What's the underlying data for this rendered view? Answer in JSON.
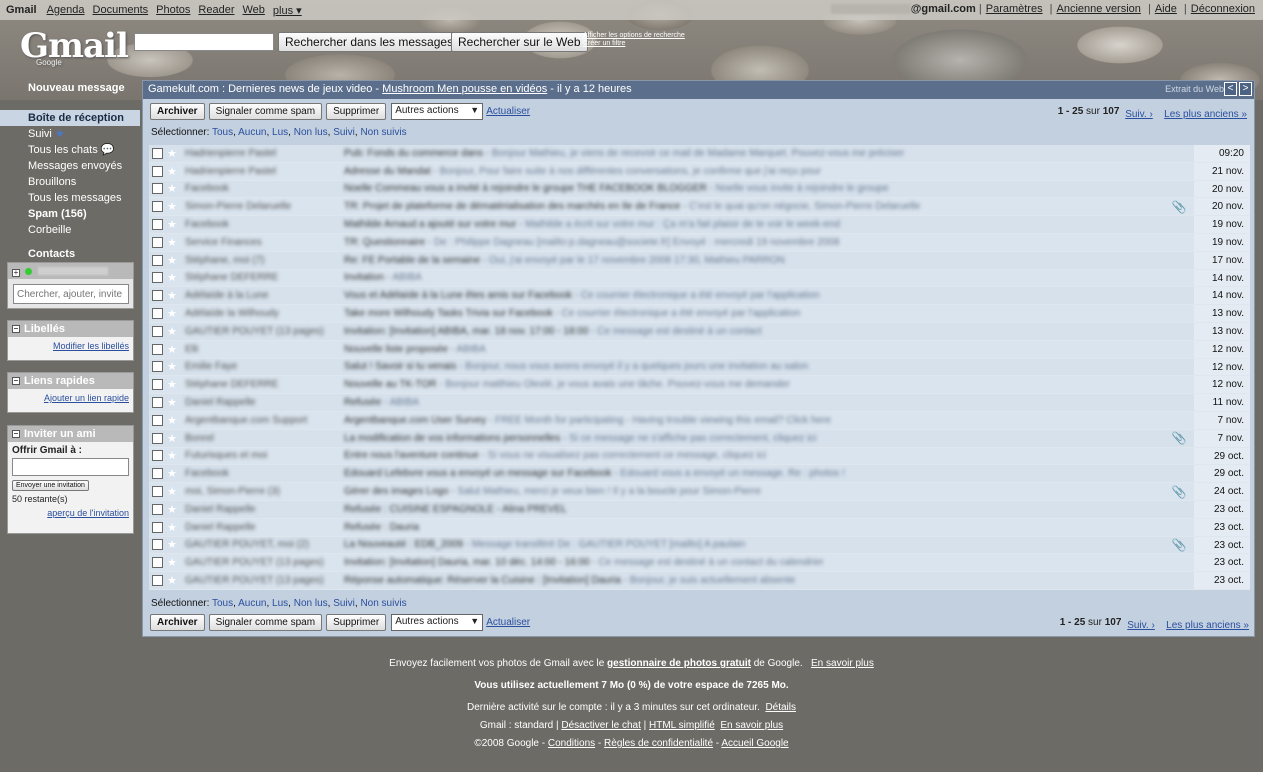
{
  "topbar": {
    "brand": "Gmail",
    "links": [
      "Agenda",
      "Documents",
      "Photos",
      "Reader",
      "Web"
    ],
    "more": "plus ▾",
    "email_domain": "@gmail.com",
    "right_links": [
      "Paramètres",
      "Ancienne version",
      "Aide",
      "Déconnexion"
    ]
  },
  "logo": {
    "text": "Gmail",
    "sub": "Google"
  },
  "search": {
    "mail_button": "Rechercher dans les messages",
    "web_button": "Rechercher sur le Web",
    "options_line1": "Afficher les options de recherche",
    "options_line2": "Créer un filtre"
  },
  "nav": {
    "compose": "Nouveau message",
    "items": [
      {
        "label": "Boîte de réception",
        "selected": true
      },
      {
        "label": "Suivi"
      },
      {
        "label": "Tous les chats"
      },
      {
        "label": "Messages envoyés"
      },
      {
        "label": "Brouillons"
      },
      {
        "label": "Tous les messages"
      },
      {
        "label": "Spam (156)",
        "bold": true
      },
      {
        "label": "Corbeille"
      }
    ],
    "contacts": "Contacts"
  },
  "chat_box": {
    "placeholder": "Chercher, ajouter, invite"
  },
  "labels_box": {
    "title": "Libellés",
    "link": "Modifier les libellés"
  },
  "quicklinks_box": {
    "title": "Liens rapides",
    "link": "Ajouter un lien rapide"
  },
  "invite_box": {
    "title": "Inviter un ami",
    "label": "Offrir Gmail à :",
    "button": "Envoyer une invitation",
    "remaining": "50 restante(s)",
    "preview": "aperçu de l'invitation"
  },
  "newsbar": {
    "source": "Gamekult.com : Dernieres news de jeux video - ",
    "headline": "Mushroom Men pousse en vidéos",
    "age": " - il y a 12 heures",
    "clip": "Extrait du Web",
    "prev": "<",
    "next": ">"
  },
  "toolbar": {
    "archive": "Archiver",
    "spam": "Signaler comme spam",
    "delete": "Supprimer",
    "actions": "Autres actions",
    "refresh": "Actualiser",
    "range": "1 - 25",
    "of": " sur ",
    "total": "107",
    "next": "Suiv. ›",
    "oldest": "Les plus anciens »"
  },
  "select_line": {
    "label": "Sélectionner: ",
    "options": [
      "Tous",
      "Aucun",
      "Lus",
      "Non lus",
      "Suivi",
      "Non suivis"
    ]
  },
  "messages": [
    {
      "sender": "Hadrienpierre Pastel",
      "subject": "Pub: Fonds du commerce dans",
      "snippet": " - Bonjour Mathieu, je viens de recevoir ce mail de Madame Marquet. Pouvez-vous me préciser",
      "date": "09:20",
      "clip": false
    },
    {
      "sender": "Hadrienpierre Pastel",
      "subject": "Adresse du Mandat",
      "snippet": " - Bonjour, Pour faire suite à nos différentes conversations, je confirme que j'ai reçu pour",
      "date": "21 nov.",
      "clip": false
    },
    {
      "sender": "Facebook",
      "subject": "Noelle Commeau vous a invité à rejoindre le groupe THE FACEBOOK BLOGGER",
      "snippet": " - Noelle vous invite à rejoindre le groupe",
      "date": "20 nov.",
      "clip": false
    },
    {
      "sender": "Simon-Pierre Delaruelle",
      "subject": "TR: Projet de plateforme de dématérialisation des marchés en Ile de France",
      "snippet": " - C'est le quai qu'on négocie, Simon-Pierre Delaruelle",
      "date": "20 nov.",
      "clip": true
    },
    {
      "sender": "Facebook",
      "subject": "Mathilde Arnaud a ajouté sur votre mur",
      "snippet": " - Mathilde a écrit sur votre mur : Ça m'a fait plaisir de te voir le week-end",
      "date": "19 nov.",
      "clip": false
    },
    {
      "sender": "Service Finances",
      "subject": "TR: Questionnaire",
      "snippet": " - De : Philippe Dagneau [mailto:p.dagneau@societe.fr] Envoyé : mercredi 19 novembre 2008",
      "date": "19 nov.",
      "clip": false
    },
    {
      "sender": "Stéphane, moi (7)",
      "subject": "Re: FE Portable de la semaine",
      "snippet": " - Oui, j'ai envoyé par le 17 novembre 2008 17:30, Mathieu PARRON",
      "date": "17 nov.",
      "clip": false
    },
    {
      "sender": "Stéphane DEFERRE",
      "subject": "Invitation",
      "snippet": " - ABIBA",
      "date": "14 nov.",
      "clip": false
    },
    {
      "sender": "Adélaïde à la Lune",
      "subject": "Vous et Adélaïde à la Lune êtes amis sur Facebook",
      "snippet": " - Ce courrier électronique a été envoyé par l'application",
      "date": "14 nov.",
      "clip": false
    },
    {
      "sender": "Adélaïde la Wilhoudy",
      "subject": "Take more Wilhoudy Tasks Trivia sur Facebook",
      "snippet": " - Ce courrier électronique a été envoyé par l'application",
      "date": "13 nov.",
      "clip": false
    },
    {
      "sender": "GAUTIER POUYET (13 pages)",
      "subject": "Invitation: [Invitation] ABIBA, mar. 18 nov. 17:00 - 18:00",
      "snippet": " - Ce message est destiné à un contact",
      "date": "13 nov.",
      "clip": false
    },
    {
      "sender": "Elli",
      "subject": "Nouvelle liste proposée",
      "snippet": " - ABIBA",
      "date": "12 nov.",
      "clip": false
    },
    {
      "sender": "Emilie Faye",
      "subject": "Salut ! Savoir si tu venais",
      "snippet": " - Bonjour, nous vous avons envoyé il y a quelques jours une invitation au salon",
      "date": "12 nov.",
      "clip": false
    },
    {
      "sender": "Stéphane DEFERRE",
      "subject": "Nouvelle au TK-TOR",
      "snippet": " - Bonjour matthieu Olexlé, je vous avais une tâche. Pouvez-vous me demander",
      "date": "12 nov.",
      "clip": false
    },
    {
      "sender": "Daniel Rappelle",
      "subject": "Refusée",
      "snippet": " - ABIBA",
      "date": "11 nov.",
      "clip": false
    },
    {
      "sender": "Argentbanque.com Support",
      "subject": "Argentbanque.com User Survey",
      "snippet": " - FREE Month for participating - Having trouble viewing this email? Click here",
      "date": "7 nov.",
      "clip": false
    },
    {
      "sender": "Bonrel",
      "subject": "La modification de vos informations personnelles",
      "snippet": " - Si ce message ne s'affiche pas correctement, cliquez ici",
      "date": "7 nov.",
      "clip": true
    },
    {
      "sender": "Futurisques et moi",
      "subject": "Entre nous l'aventure continue",
      "snippet": " - Si vous ne visualisez pas correctement ce message, cliquez ici",
      "date": "29 oct.",
      "clip": false
    },
    {
      "sender": "Facebook",
      "subject": "Edouard Lefebvre vous a envoyé un message sur Facebook",
      "snippet": " - Edouard vous a envoyé un message. Re : photos !",
      "date": "29 oct.",
      "clip": false
    },
    {
      "sender": "moi, Simon-Pierre (3)",
      "subject": "Gérer des images Logo",
      "snippet": " - Salut Mathieu, merci je veux bien ! Il y a la boucle pour Simon-Pierre",
      "date": "24 oct.",
      "clip": true
    },
    {
      "sender": "Daniel Rappelle",
      "subject": "Refusée : CUISINE ESPAGNOLE - Alina PREVEL",
      "snippet": "",
      "date": "23 oct.",
      "clip": false
    },
    {
      "sender": "Daniel Rappelle",
      "subject": "Refusée : Dauria",
      "snippet": "",
      "date": "23 oct.",
      "clip": false
    },
    {
      "sender": "GAUTIER POUYET, moi (2)",
      "subject": "La Nouveauté : EDB_2009",
      "snippet": " - Message transféré De : GAUTIER POUYET [mailto] A paulain",
      "date": "23 oct.",
      "clip": true
    },
    {
      "sender": "GAUTIER POUYET (13 pages)",
      "subject": "Invitation: [Invitation] Dauria, mar. 10 déc. 14:00 - 16:00",
      "snippet": " - Ce message est destiné à un contact du calendrier",
      "date": "23 oct.",
      "clip": false
    },
    {
      "sender": "GAUTIER POUYET (13 pages)",
      "subject": "Réponse automatique: Réserver la Cuisine : [Invitation] Dauria",
      "snippet": " - Bonjour, je suis actuellement absente",
      "date": "23 oct.",
      "clip": false
    }
  ],
  "footer": {
    "photos_pre": "Envoyez facilement vos photos de Gmail avec le ",
    "photos_link": "gestionnaire de photos gratuit",
    "photos_post": " de Google.",
    "learn_more": "En savoir plus",
    "usage": "Vous utilisez actuellement 7 Mo (0 %) de votre espace de 7265 Mo.",
    "activity": "Dernière activité sur le compte : il y a 3 minutes sur cet ordinateur.",
    "details": "Détails",
    "view_label": "Gmail : standard",
    "disable_chat": "Désactiver le chat",
    "html_simple": "HTML simplifié",
    "learn_more2": "En savoir plus",
    "copyright": "©2008 Google",
    "terms": "Conditions",
    "privacy": "Règles de confidentialité",
    "home": "Accueil Google"
  }
}
